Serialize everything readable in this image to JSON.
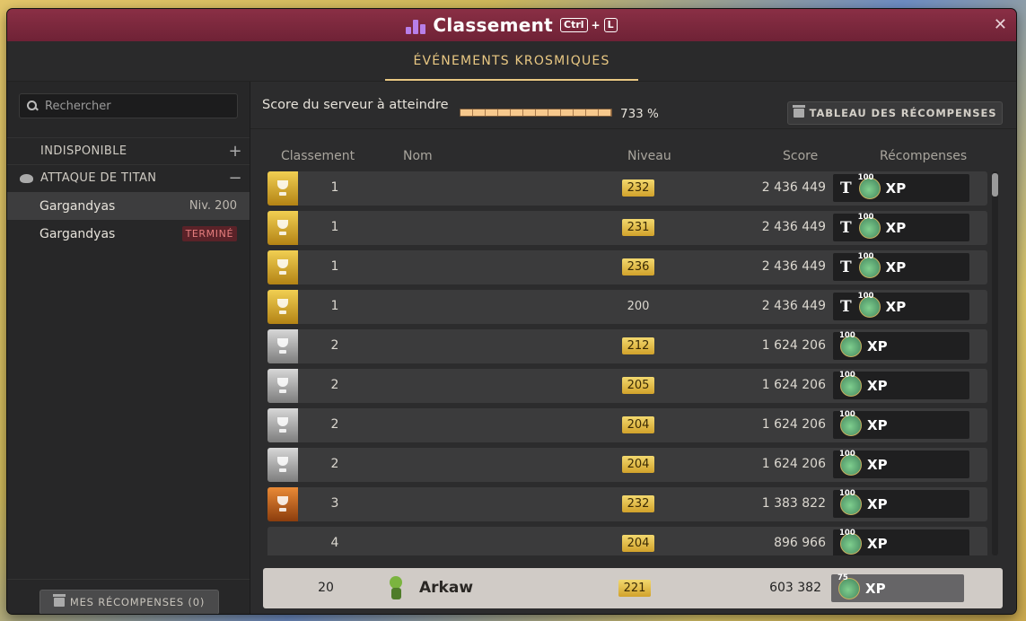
{
  "window": {
    "title": "Classement",
    "shortcut_mod": "Ctrl",
    "shortcut_plus": "+",
    "shortcut_key": "L",
    "close_icon": "close-icon",
    "colors": {
      "titlebar": "#7d2940",
      "accent": "#e9c883",
      "gold": "#f1cf52",
      "panel": "#2a2a2b"
    }
  },
  "tab": {
    "label": "ÉVÉNEMENTS KROSMIQUES"
  },
  "sidebar": {
    "search_placeholder": "Rechercher",
    "categories": [
      {
        "label": "INDISPONIBLE",
        "toggle": "+"
      },
      {
        "label": "ATTAQUE DE TITAN",
        "toggle": "−"
      }
    ],
    "entries": [
      {
        "name": "Gargandyas",
        "right": "Niv. 200"
      },
      {
        "name": "Gargandyas",
        "right": "TERMINÉ"
      }
    ],
    "my_rewards_label": "MES RÉCOMPENSES (0)"
  },
  "goal": {
    "label": "Score du serveur à atteindre",
    "progress_fraction": 1.0,
    "progress_text": "733 %",
    "rewards_button": "TABLEAU DES RÉCOMPENSES"
  },
  "table": {
    "headers": {
      "rank": "Classement",
      "name": "Nom",
      "level": "Niveau",
      "score": "Score",
      "rewards": "Récompenses"
    },
    "rows": [
      {
        "cup": "gold",
        "rank": "1",
        "level": "232",
        "level_badge": true,
        "score": "2 436 449",
        "title": true,
        "pot": "100",
        "xp": "XP"
      },
      {
        "cup": "gold",
        "rank": "1",
        "level": "231",
        "level_badge": true,
        "score": "2 436 449",
        "title": true,
        "pot": "100",
        "xp": "XP"
      },
      {
        "cup": "gold",
        "rank": "1",
        "level": "236",
        "level_badge": true,
        "score": "2 436 449",
        "title": true,
        "pot": "100",
        "xp": "XP"
      },
      {
        "cup": "gold",
        "rank": "1",
        "level": "200",
        "level_badge": false,
        "score": "2 436 449",
        "title": true,
        "pot": "100",
        "xp": "XP"
      },
      {
        "cup": "silver",
        "rank": "2",
        "level": "212",
        "level_badge": true,
        "score": "1 624 206",
        "title": false,
        "pot": "100",
        "xp": "XP"
      },
      {
        "cup": "silver",
        "rank": "2",
        "level": "205",
        "level_badge": true,
        "score": "1 624 206",
        "title": false,
        "pot": "100",
        "xp": "XP"
      },
      {
        "cup": "silver",
        "rank": "2",
        "level": "204",
        "level_badge": true,
        "score": "1 624 206",
        "title": false,
        "pot": "100",
        "xp": "XP"
      },
      {
        "cup": "silver",
        "rank": "2",
        "level": "204",
        "level_badge": true,
        "score": "1 624 206",
        "title": false,
        "pot": "100",
        "xp": "XP"
      },
      {
        "cup": "bronze",
        "rank": "3",
        "level": "232",
        "level_badge": true,
        "score": "1 383 822",
        "title": false,
        "pot": "100",
        "xp": "XP"
      },
      {
        "cup": "none",
        "rank": "4",
        "level": "204",
        "level_badge": true,
        "score": "896 966",
        "title": false,
        "pot": "100",
        "xp": "XP"
      }
    ],
    "title_letter": "T"
  },
  "you": {
    "rank": "20",
    "name": "Arkaw",
    "level": "221",
    "score": "603 382",
    "pot": "75",
    "xp": "XP"
  }
}
